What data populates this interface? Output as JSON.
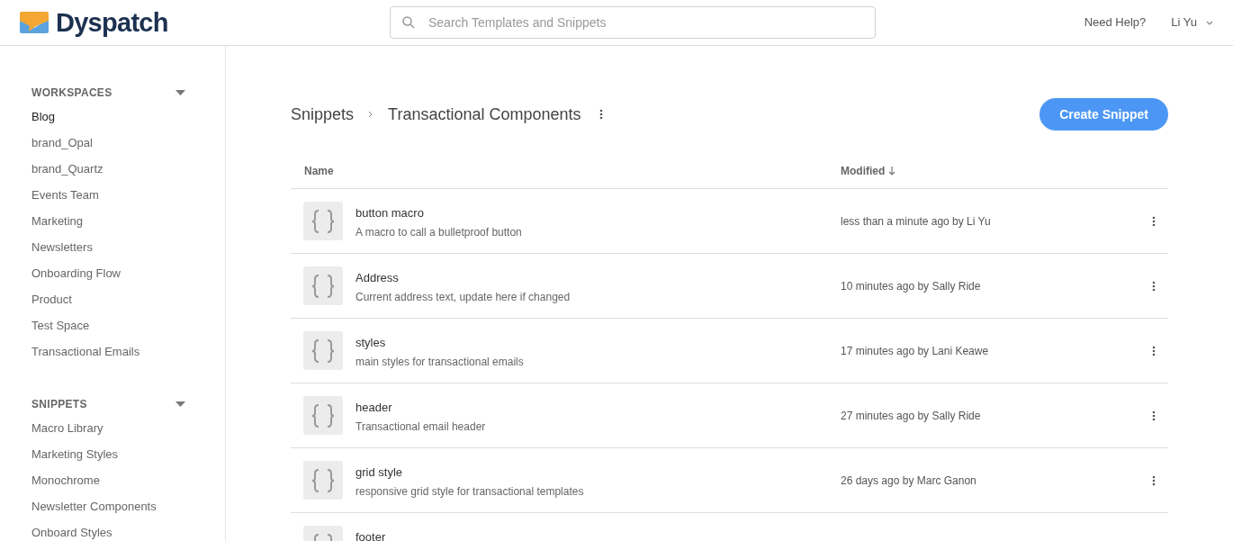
{
  "header": {
    "logo_text": "Dyspatch",
    "search": {
      "placeholder": "Search Templates and Snippets"
    },
    "help_link": "Need Help?",
    "user_menu": "Li Yu"
  },
  "sidebar": {
    "sections": [
      {
        "title": "WORKSPACES",
        "expanded": true,
        "items": [
          {
            "label": "Blog",
            "selected": true
          },
          {
            "label": "brand_Opal",
            "selected": false
          },
          {
            "label": "brand_Quartz",
            "selected": false
          },
          {
            "label": "Events Team",
            "selected": false
          },
          {
            "label": "Marketing",
            "selected": false
          },
          {
            "label": "Newsletters",
            "selected": false
          },
          {
            "label": "Onboarding Flow",
            "selected": false
          },
          {
            "label": "Product",
            "selected": false
          },
          {
            "label": "Test Space",
            "selected": false
          },
          {
            "label": "Transactional Emails",
            "selected": false
          }
        ]
      },
      {
        "title": "SNIPPETS",
        "expanded": true,
        "items": [
          {
            "label": "Macro Library",
            "selected": false
          },
          {
            "label": "Marketing Styles",
            "selected": false
          },
          {
            "label": "Monochrome",
            "selected": false
          },
          {
            "label": "Newsletter Components",
            "selected": false
          },
          {
            "label": "Onboard Styles",
            "selected": false
          }
        ]
      }
    ]
  },
  "breadcrumb": [
    "Snippets",
    "Transactional Components"
  ],
  "create_button": "Create Snippet",
  "table": {
    "columns": [
      "Name",
      "Modified"
    ],
    "rows": [
      {
        "name": "button macro",
        "description": "A macro to call a bulletproof button",
        "modified": "less than a minute ago by Li Yu"
      },
      {
        "name": "Address",
        "description": "Current address text, update here if changed",
        "modified": "10 minutes ago by Sally Ride"
      },
      {
        "name": "styles",
        "description": "main styles for transactional emails",
        "modified": "17 minutes ago by Lani Keawe"
      },
      {
        "name": "header",
        "description": "Transactional email header",
        "modified": "27 minutes ago by Sally Ride"
      },
      {
        "name": "grid style",
        "description": "responsive grid style for transactional templates",
        "modified": "26 days ago by Marc Ganon"
      },
      {
        "name": "footer"
      }
    ]
  }
}
